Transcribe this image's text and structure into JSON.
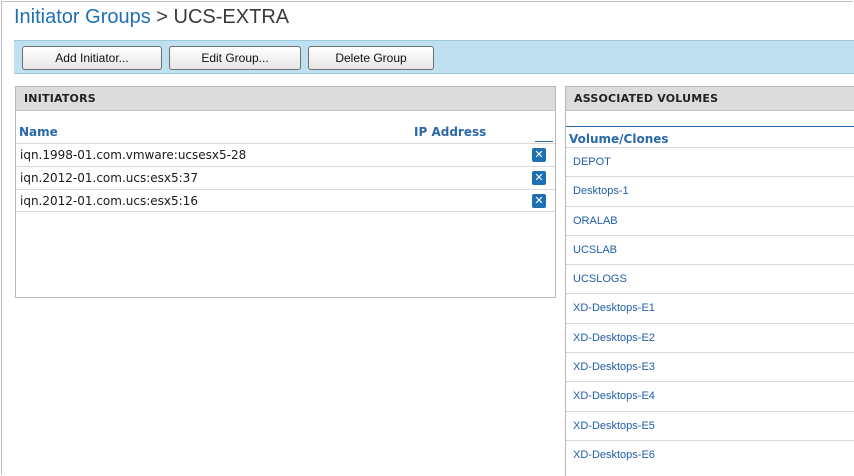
{
  "breadcrumb": {
    "parent": "Initiator Groups",
    "separator": " > ",
    "current": "UCS-EXTRA"
  },
  "toolbar": {
    "add_initiator": "Add Initiator...",
    "edit_group": "Edit Group...",
    "delete_group": "Delete Group"
  },
  "initiators": {
    "title": "INITIATORS",
    "columns": {
      "name": "Name",
      "ip": "IP Address"
    },
    "rows": [
      {
        "name": "iqn.1998-01.com.vmware:ucsesx5-28",
        "remove_icon": "remove-icon"
      },
      {
        "name": "iqn.2012-01.com.ucs:esx5:37",
        "remove_icon": "remove-icon"
      },
      {
        "name": "iqn.2012-01.com.ucs:esx5:16",
        "remove_icon": "remove-icon"
      }
    ]
  },
  "volumes": {
    "title": "ASSOCIATED VOLUMES",
    "column": "Volume/Clones",
    "items": [
      "DEPOT",
      "Desktops-1",
      "ORALAB",
      "UCSLAB",
      "UCSLOGS",
      "XD-Desktops-E1",
      "XD-Desktops-E2",
      "XD-Desktops-E3",
      "XD-Desktops-E4",
      "XD-Desktops-E5",
      "XD-Desktops-E6"
    ]
  },
  "colors": {
    "link": "#1e6fb8",
    "toolbar_bg": "#bfe0ee",
    "header_bg": "#dcdcdc",
    "remove_icon": "#1f6fb5"
  }
}
